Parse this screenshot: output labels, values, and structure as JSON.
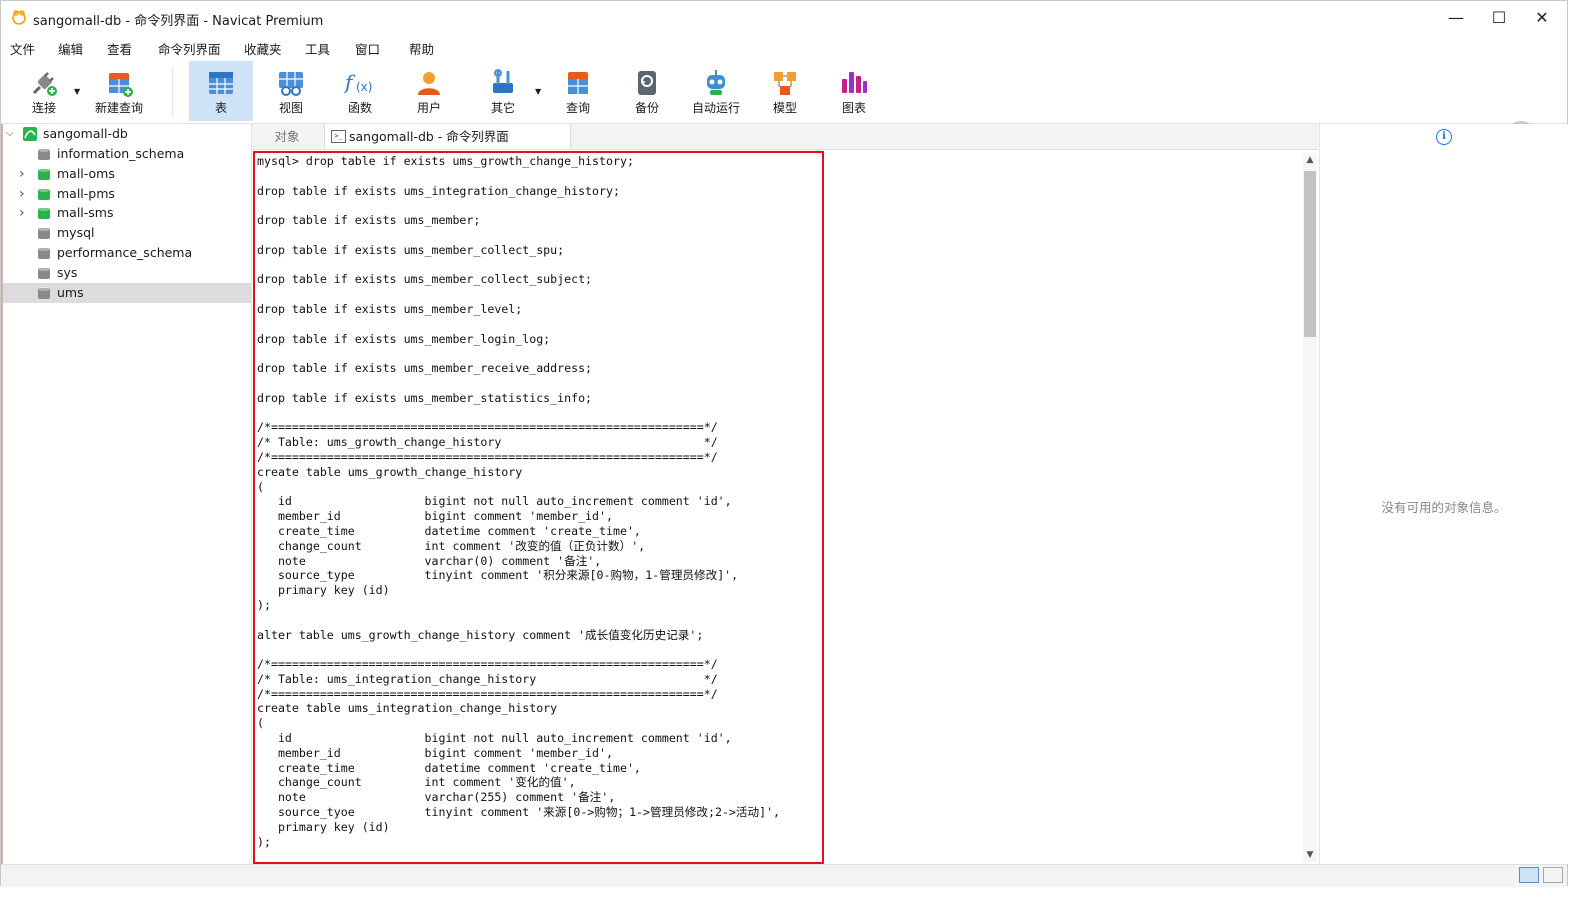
{
  "window": {
    "title": "sangomall-db - 命令列界面 - Navicat Premium",
    "controls": {
      "minimize": "—",
      "maximize": "☐",
      "close": "✕"
    }
  },
  "menu": [
    "文件",
    "编辑",
    "查看",
    "命令列界面",
    "收藏夹",
    "工具",
    "窗口",
    "帮助"
  ],
  "toolbar": [
    {
      "label": "连接",
      "icon": "connection-plug-icon"
    },
    {
      "label": "新建查询",
      "icon": "new-query-icon"
    },
    {
      "label": "表",
      "icon": "table-icon",
      "active": true
    },
    {
      "label": "视图",
      "icon": "view-icon"
    },
    {
      "label": "函数",
      "icon": "function-icon"
    },
    {
      "label": "用户",
      "icon": "user-icon"
    },
    {
      "label": "其它",
      "icon": "tools-icon"
    },
    {
      "label": "查询",
      "icon": "query-icon"
    },
    {
      "label": "备份",
      "icon": "backup-icon"
    },
    {
      "label": "自动运行",
      "icon": "robot-icon"
    },
    {
      "label": "模型",
      "icon": "model-icon"
    },
    {
      "label": "图表",
      "icon": "chart-icon"
    }
  ],
  "sidebar": {
    "connection": "sangomall-db",
    "databases": [
      {
        "name": "information_schema",
        "color": "#8a8a8a",
        "expandable": false
      },
      {
        "name": "mall-oms",
        "color": "#2bb24c",
        "expandable": true
      },
      {
        "name": "mall-pms",
        "color": "#2bb24c",
        "expandable": true
      },
      {
        "name": "mall-sms",
        "color": "#2bb24c",
        "expandable": true
      },
      {
        "name": "mysql",
        "color": "#8a8a8a",
        "expandable": false
      },
      {
        "name": "performance_schema",
        "color": "#8a8a8a",
        "expandable": false
      },
      {
        "name": "sys",
        "color": "#8a8a8a",
        "expandable": false
      },
      {
        "name": "ums",
        "color": "#8a8a8a",
        "expandable": false,
        "selected": true
      }
    ]
  },
  "tabs": {
    "objects": "对象",
    "active": "sangomall-db - 命令列界面",
    "active_icon_text": ">_"
  },
  "console": {
    "text": "mysql> drop table if exists ums_growth_change_history;\n\ndrop table if exists ums_integration_change_history;\n\ndrop table if exists ums_member;\n\ndrop table if exists ums_member_collect_spu;\n\ndrop table if exists ums_member_collect_subject;\n\ndrop table if exists ums_member_level;\n\ndrop table if exists ums_member_login_log;\n\ndrop table if exists ums_member_receive_address;\n\ndrop table if exists ums_member_statistics_info;\n\n/*==============================================================*/\n/* Table: ums_growth_change_history                             */\n/*==============================================================*/\ncreate table ums_growth_change_history\n(\n   id                   bigint not null auto_increment comment 'id',\n   member_id            bigint comment 'member_id',\n   create_time          datetime comment 'create_time',\n   change_count         int comment '改变的值（正负计数）',\n   note                 varchar(0) comment '备注',\n   source_type          tinyint comment '积分来源[0-购物，1-管理员修改]',\n   primary key (id)\n);\n\nalter table ums_growth_change_history comment '成长值变化历史记录';\n\n/*==============================================================*/\n/* Table: ums_integration_change_history                        */\n/*==============================================================*/\ncreate table ums_integration_change_history\n(\n   id                   bigint not null auto_increment comment 'id',\n   member_id            bigint comment 'member_id',\n   create_time          datetime comment 'create_time',\n   change_count         int comment '变化的值',\n   note                 varchar(255) comment '备注',\n   source_tyoe          tinyint comment '来源[0->购物；1->管理员修改;2->活动]',\n   primary key (id)\n);"
  },
  "info_panel": {
    "empty_text": "没有可用的对象信息。"
  },
  "colors": {
    "highlight_border": "#e0101c",
    "active_toolbar": "#cfe3f7",
    "selected_row": "#dcdcdc"
  }
}
